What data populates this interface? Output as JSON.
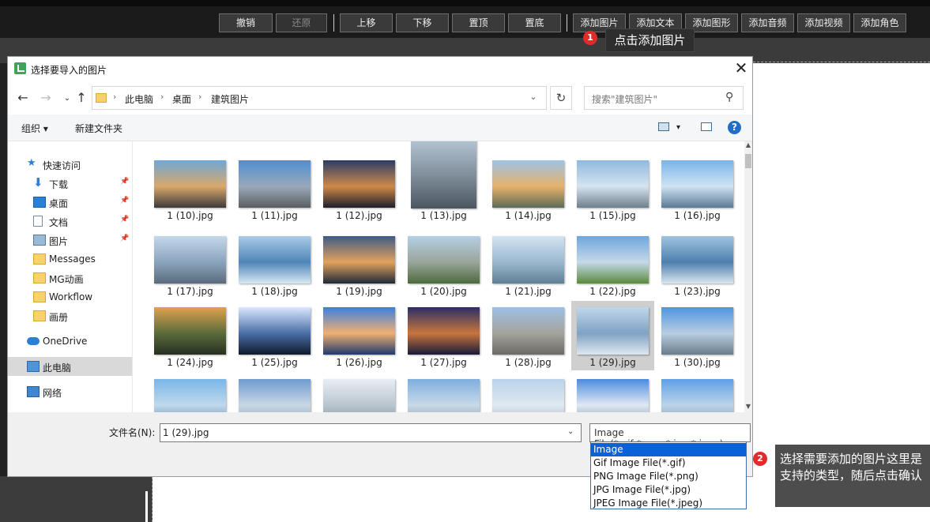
{
  "toolbar": {
    "buttons": [
      {
        "label": "撤销",
        "disabled": false
      },
      {
        "label": "还原",
        "disabled": true
      },
      {
        "label": "上移",
        "disabled": false
      },
      {
        "label": "下移",
        "disabled": false
      },
      {
        "label": "置顶",
        "disabled": false
      },
      {
        "label": "置底",
        "disabled": false
      },
      {
        "label": "添加图片",
        "disabled": false
      },
      {
        "label": "添加文本",
        "disabled": false
      },
      {
        "label": "添加图形",
        "disabled": false
      },
      {
        "label": "添加音频",
        "disabled": false
      },
      {
        "label": "添加视频",
        "disabled": false
      },
      {
        "label": "添加角色",
        "disabled": false
      }
    ]
  },
  "callouts": {
    "step1": {
      "badge": "1",
      "text": "点击添加图片"
    },
    "step2": {
      "badge": "2",
      "text": "选择需要添加的图片这里是支持的类型，随后点击确认"
    }
  },
  "dialog": {
    "title": "选择要导入的图片",
    "close_glyph": "✕",
    "nav": {
      "back": "←",
      "forward": "→",
      "up": "↑"
    },
    "breadcrumb": [
      "此电脑",
      "桌面",
      "建筑图片"
    ],
    "crumb_sep": "›",
    "dropdown_glyph": "⌄",
    "refresh_glyph": "↻",
    "search_placeholder": "搜索\"建筑图片\"",
    "search_glyph": "⚲",
    "organize": "组织 ▾",
    "new_folder": "新建文件夹",
    "view_menu_glyph": "▾",
    "help": "?",
    "sidebar": [
      {
        "label": "快速访问",
        "icon": "star-icon"
      },
      {
        "label": "下载",
        "icon": "download-icon",
        "pinned": true
      },
      {
        "label": "桌面",
        "icon": "desktop-icon",
        "pinned": true
      },
      {
        "label": "文档",
        "icon": "document-icon",
        "pinned": true
      },
      {
        "label": "图片",
        "icon": "pictures-icon",
        "pinned": true
      },
      {
        "label": "Messages",
        "icon": "folder-icon"
      },
      {
        "label": "MG动画",
        "icon": "folder-icon"
      },
      {
        "label": "Workflow",
        "icon": "folder-icon"
      },
      {
        "label": "画册",
        "icon": "folder-icon"
      },
      {
        "label": "OneDrive",
        "icon": "cloud-icon"
      },
      {
        "label": "此电脑",
        "icon": "computer-icon",
        "selected": true
      },
      {
        "label": "网络",
        "icon": "network-icon"
      }
    ],
    "files": [
      {
        "name": "1 (10).jpg",
        "colors": [
          "#6fa7d6",
          "#d9a86b",
          "#3c3a3a"
        ]
      },
      {
        "name": "1 (11).jpg",
        "colors": [
          "#4c8fd4",
          "#9aa9b8",
          "#5a5e63"
        ]
      },
      {
        "name": "1 (12).jpg",
        "colors": [
          "#2a3d66",
          "#d08a4a",
          "#1d1f2b"
        ]
      },
      {
        "name": "1 (13).jpg",
        "colors": [
          "#b8c9d8",
          "#7f8d99",
          "#4b5660"
        ]
      },
      {
        "name": "1 (14).jpg",
        "colors": [
          "#9ec3e6",
          "#e6b16a",
          "#5e6b57"
        ]
      },
      {
        "name": "1 (15).jpg",
        "colors": [
          "#8fb8e0",
          "#d6e4ef",
          "#6e7f8c"
        ]
      },
      {
        "name": "1 (16).jpg",
        "colors": [
          "#79b4e8",
          "#cfe3f3",
          "#5c7a96"
        ]
      },
      {
        "name": "1 (17).jpg",
        "colors": [
          "#c5d8ea",
          "#8aa4bd",
          "#5b6b7a"
        ]
      },
      {
        "name": "1 (18).jpg",
        "colors": [
          "#a9cbe8",
          "#4f86b8",
          "#d6e7f3"
        ]
      },
      {
        "name": "1 (19).jpg",
        "colors": [
          "#3d5b86",
          "#e3a15c",
          "#1f2a3a"
        ]
      },
      {
        "name": "1 (20).jpg",
        "colors": [
          "#b5cfe6",
          "#9aa59a",
          "#4d6a3f"
        ]
      },
      {
        "name": "1 (21).jpg",
        "colors": [
          "#d3e4f2",
          "#9cb8cf",
          "#5f7f93"
        ]
      },
      {
        "name": "1 (22).jpg",
        "colors": [
          "#6ea6dd",
          "#c6d9e8",
          "#5a8b3d"
        ]
      },
      {
        "name": "1 (23).jpg",
        "colors": [
          "#9fc4e0",
          "#4e7fae",
          "#d8e6f0"
        ]
      },
      {
        "name": "1 (24).jpg",
        "colors": [
          "#e0a24d",
          "#5a6b3a",
          "#263022"
        ]
      },
      {
        "name": "1 (25).jpg",
        "colors": [
          "#dbe8ff",
          "#4a6fa8",
          "#101a2e"
        ]
      },
      {
        "name": "1 (26).jpg",
        "colors": [
          "#3c7fe0",
          "#f0b070",
          "#1e3a6e"
        ]
      },
      {
        "name": "1 (27).jpg",
        "colors": [
          "#2a2e66",
          "#c8763c",
          "#171a3a"
        ]
      },
      {
        "name": "1 (28).jpg",
        "colors": [
          "#9cc0e4",
          "#a5a39c",
          "#6c6a66"
        ]
      },
      {
        "name": "1 (29).jpg",
        "colors": [
          "#c0d7ec",
          "#7fa2c4",
          "#dfe7ef"
        ],
        "selected": true
      },
      {
        "name": "1 (30).jpg",
        "colors": [
          "#4f95e2",
          "#b7cde0",
          "#6a7d8c"
        ]
      },
      {
        "name": "",
        "colors": [
          "#79b6e8",
          "#bfd8ec",
          "#6a8aa5"
        ]
      },
      {
        "name": "",
        "colors": [
          "#6f9bd0",
          "#c9d7e4",
          "#8aa0b3"
        ]
      },
      {
        "name": "",
        "colors": [
          "#e8eef3",
          "#b9c6cf",
          "#7f8f9a"
        ]
      },
      {
        "name": "",
        "colors": [
          "#7eaede",
          "#c8d9e8",
          "#8c9ba6"
        ]
      },
      {
        "name": "",
        "colors": [
          "#b9d2ea",
          "#e0e9f1",
          "#9db0bf"
        ]
      },
      {
        "name": "",
        "colors": [
          "#4c8be0",
          "#dfe9f2",
          "#7c95aa"
        ]
      },
      {
        "name": "",
        "colors": [
          "#5f9fe6",
          "#bcd4ea",
          "#8095a6"
        ]
      }
    ],
    "file_name_label": "文件名(N):",
    "file_name_value": "1 (29).jpg",
    "file_type_value": "Image File(*.gif;*.png;*.jpg;*.jpeg)",
    "file_type_options": [
      "Image File(*.gif;*.png;*.jpg;*.jpeg)",
      "Gif Image File(*.gif)",
      "PNG Image File(*.png)",
      "JPG Image File(*.jpg)",
      "JPEG Image File(*.jpeg)"
    ],
    "file_type_selected_index": 0
  }
}
